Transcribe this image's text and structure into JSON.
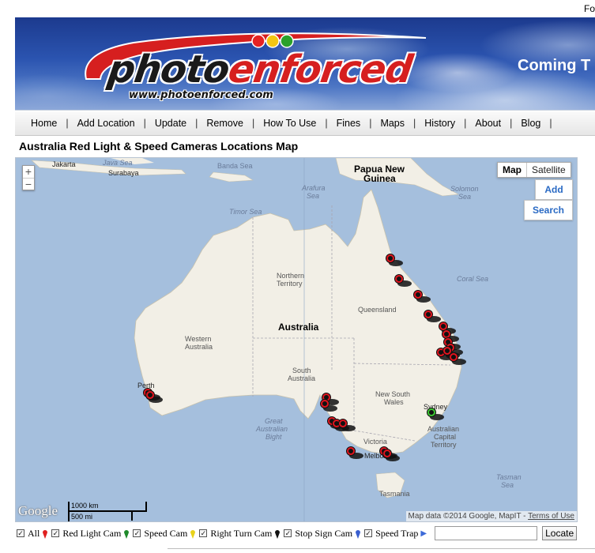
{
  "header": {
    "top_right_text": "Fo",
    "logo_part1": "photo",
    "logo_part2": "enforced",
    "logo_url": "www.photoenforced.com",
    "coming_text": "Coming T"
  },
  "nav": {
    "items": [
      "Home",
      "Add Location",
      "Update",
      "Remove",
      "How To Use",
      "Fines",
      "Maps",
      "History",
      "About",
      "Blog"
    ],
    "separator": "|"
  },
  "page_title": "Australia Red Light & Speed Cameras Locations Map",
  "map": {
    "zoom_in": "+",
    "zoom_out": "−",
    "map_type_active": "Map",
    "map_type_other": "Satellite",
    "add_button": "Add",
    "search_button": "Search",
    "labels": {
      "jakarta": "Jakarta",
      "surabaya": "Surabaya",
      "java_sea": "Java Sea",
      "banda_sea": "Banda Sea",
      "papua": "Papua New",
      "guinea": "Guinea",
      "arafura": "Arafura",
      "arafura_sea": "Sea",
      "solomon": "Solomon",
      "solomon_sea": "Sea",
      "timor_sea": "Timor Sea",
      "coral_sea": "Coral Sea",
      "northern": "Northern",
      "territory": "Territory",
      "queensland": "Queensland",
      "australia": "Australia",
      "western": "Western",
      "western_aus": "Australia",
      "south": "South",
      "south_aus": "Australia",
      "nsw1": "New South",
      "nsw2": "Wales",
      "perth": "Perth",
      "sydney": "Sydney",
      "act1": "Australian",
      "act2": "Capital",
      "act3": "Territory",
      "great": "Great",
      "great2": "Australian",
      "great3": "Bight",
      "victoria": "Victoria",
      "melbourne": "Melbourne",
      "tasmania": "Tasmania",
      "tasman": "Tasman",
      "tasman_sea": "Sea"
    },
    "google_logo": "Google",
    "scale_km": "1000 km",
    "scale_mi": "500 mi",
    "attribution": "Map data ©2014 Google, MapIT - ",
    "terms": "Terms of Use",
    "colors": {
      "water": "#a5bfdd",
      "land": "#f2efe6",
      "red_marker": "#e1141e",
      "green_marker": "#3cc832"
    }
  },
  "legend": {
    "all": "All",
    "red_light": "Red Light Cam",
    "speed": "Speed Cam",
    "right_turn": "Right Turn Cam",
    "stop_sign": "Stop Sign Cam",
    "speed_trap": "Speed Trap",
    "location_value": "",
    "locate_button": "Locate",
    "pin_colors": {
      "red_light": "#e02020",
      "speed": "#1e8a2a",
      "right_turn": "#e8d21a",
      "stop_sign": "#111111",
      "speed_trap": "#3a5fd0"
    }
  }
}
